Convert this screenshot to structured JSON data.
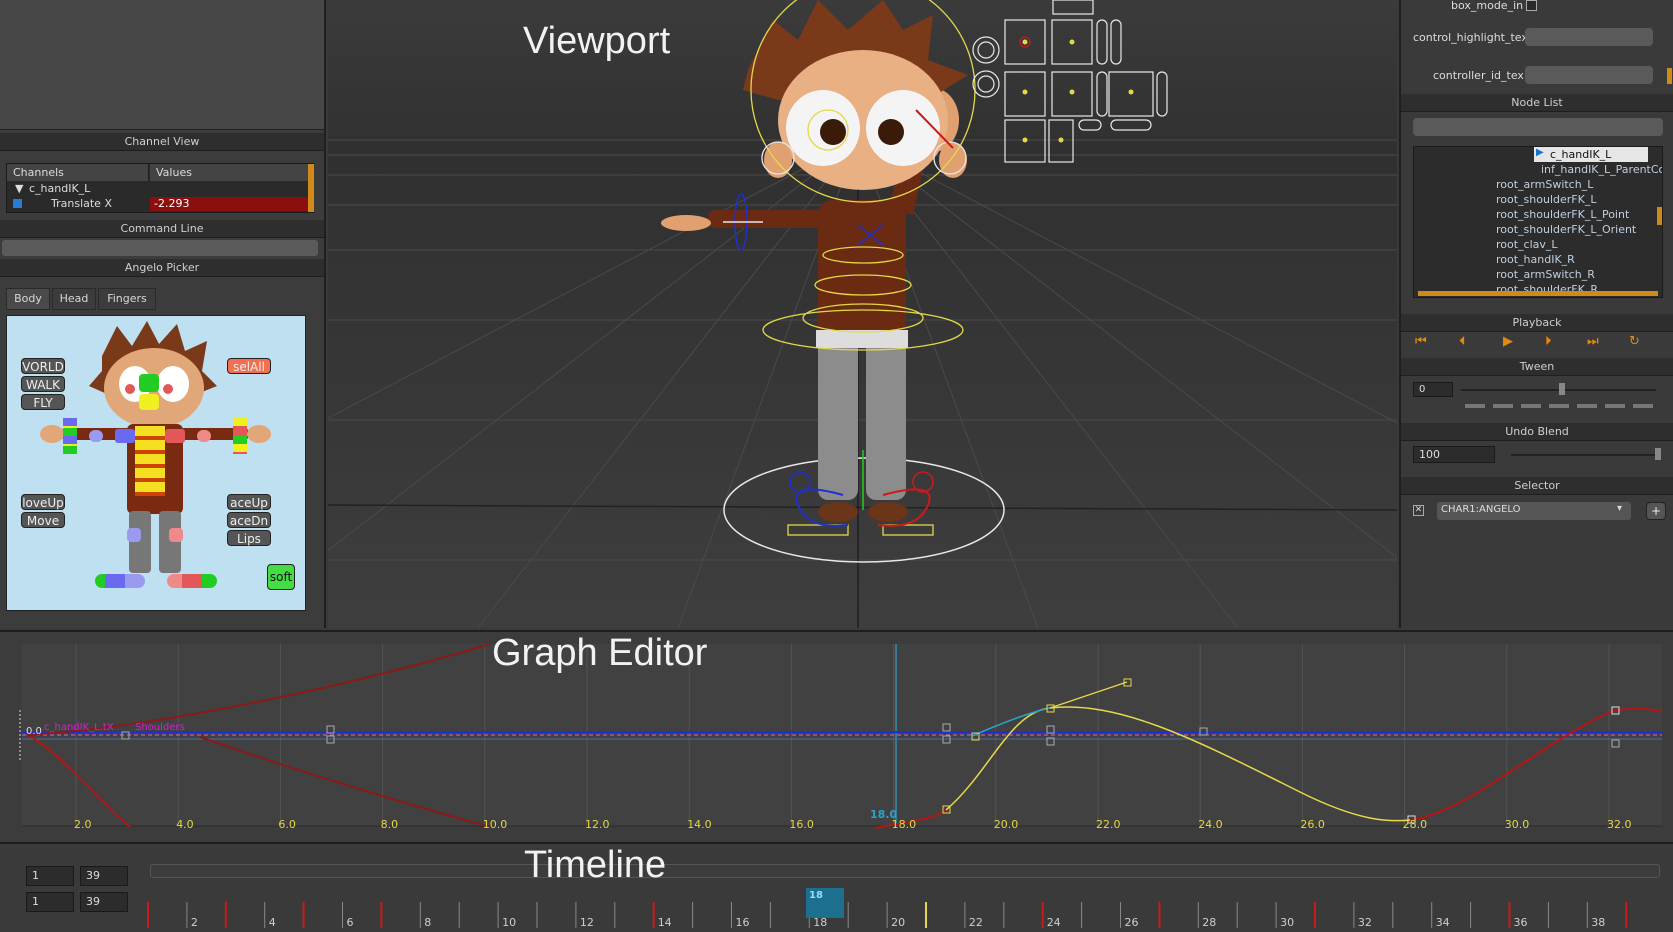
{
  "colors": {
    "accent": "#2aa3c9",
    "key_red": "#cc1a1a",
    "key_yellow": "#e3d84a",
    "curve_yellow": "#e8d84a",
    "curve_red": "#b81414",
    "curve_blue": "#1f2fd0",
    "picker_bg": "#bfe0f0"
  },
  "viewport": {
    "overlay_label": "Viewport"
  },
  "channel_view": {
    "header": "Channel View",
    "col_channels": "Channels",
    "col_values": "Values",
    "node": "c_handIK_L",
    "attr": "Translate X",
    "value": "-2.293"
  },
  "command_line": {
    "header": "Command Line",
    "value": ""
  },
  "picker": {
    "header": "Angelo Picker",
    "tabs": [
      "Body",
      "Head",
      "Fingers"
    ],
    "buttons": {
      "world": "VORLD",
      "walk": "WALK",
      "fly": "FLY",
      "selall": "selAll",
      "move_up": "loveUp",
      "move": "Move",
      "face_up": "aceUp",
      "face_dn": "aceDn",
      "lips": "Lips",
      "soft": "soft"
    }
  },
  "right_panel": {
    "box_mode": "box_mode_in",
    "control_highlight": "control_highlight_tex",
    "controller_id": "controller_id_tex",
    "node_list_header": "Node List",
    "nodes": [
      "c_handIK_L",
      "inf_handIK_L_ParentCo",
      "root_armSwitch_L",
      "root_shoulderFK_L",
      "root_shoulderFK_L_Point",
      "root_shoulderFK_L_Orient",
      "root_clav_L",
      "root_handIK_R",
      "root_armSwitch_R",
      "root_shoulderFK_R"
    ],
    "playback_header": "Playback",
    "tween_header": "Tween",
    "tween_value": "0",
    "undo_header": "Undo Blend",
    "undo_value": "100",
    "selector_header": "Selector",
    "selector_value": "CHAR1:ANGELO",
    "add_label": "+"
  },
  "graph_editor": {
    "overlay_label": "Graph Editor",
    "channel_label": "c_handIK_L.tX",
    "overlap_label": "Shoulders",
    "y_label": "0.0",
    "current_frame_label": "18.0",
    "x_ticks": [
      "2.0",
      "4.0",
      "6.0",
      "8.0",
      "10.0",
      "12.0",
      "14.0",
      "16.0",
      "18.0",
      "20.0",
      "22.0",
      "24.0",
      "26.0",
      "28.0",
      "30.0",
      "32.0"
    ]
  },
  "timeline": {
    "overlay_label": "Timeline",
    "start": "1",
    "end": "39",
    "range_start": "1",
    "range_end": "39",
    "current_frame": "18",
    "ticks": [
      "2",
      "4",
      "6",
      "8",
      "10",
      "12",
      "14",
      "16",
      "18",
      "20",
      "22",
      "24",
      "26",
      "28",
      "30",
      "32",
      "34",
      "36",
      "38"
    ]
  },
  "rig_controls": {
    "dots": [
      "smile-icon",
      "neutral-face-icon"
    ]
  }
}
